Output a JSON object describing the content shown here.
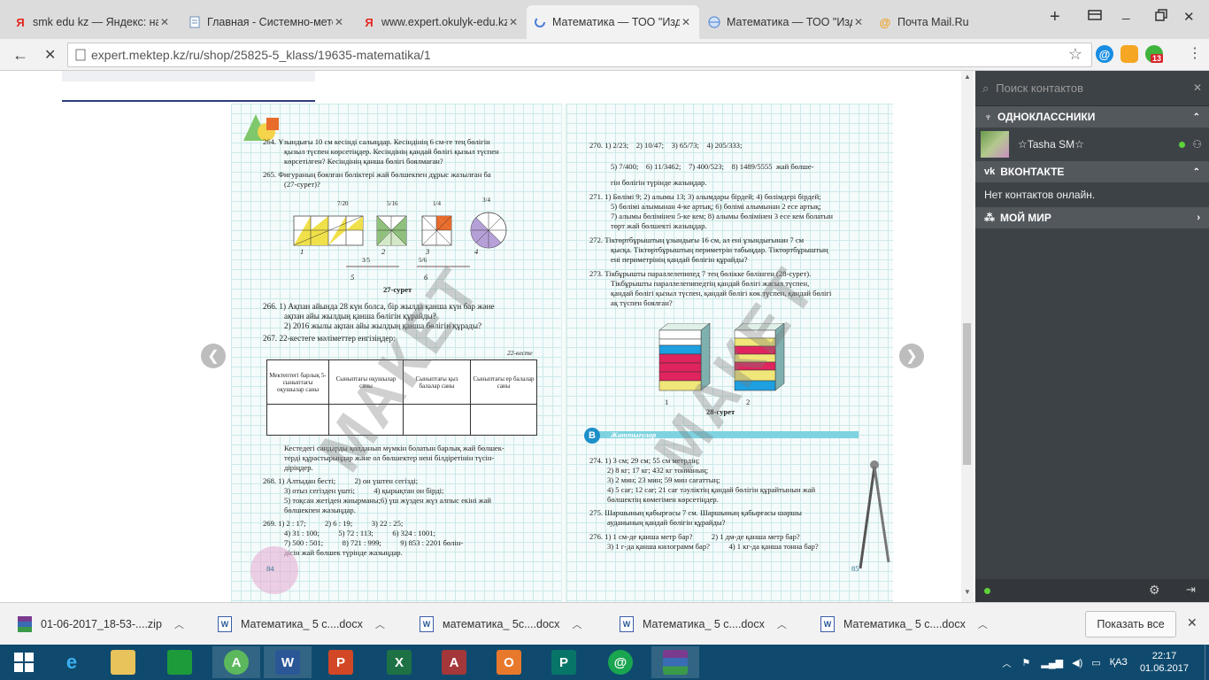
{
  "browser": {
    "tabs": [
      {
        "title": "smk edu kz — Яндекс: нашл",
        "favicon": "Я",
        "color": "#e52620",
        "active": false
      },
      {
        "title": "Главная - Системно-методи",
        "favicon": "doc",
        "color": "#6d8fc0",
        "active": false
      },
      {
        "title": "www.expert.okulyk-edu.kz —",
        "favicon": "Я",
        "color": "#e52620",
        "active": false
      },
      {
        "title": "Математика — ТОО \"Издате",
        "favicon": "loading",
        "color": "#4a7fd6",
        "active": true
      },
      {
        "title": "Математика — ТОО \"Издате",
        "favicon": "globe",
        "color": "#4a7fd6",
        "active": false
      },
      {
        "title": "Почта Mail.Ru",
        "favicon": "@",
        "color": "#f0a020",
        "active": false
      }
    ],
    "url": "expert.mektep.kz/ru/shop/25825-5_klass/19635-matematika/1",
    "badge_count": "13"
  },
  "book": {
    "left_page": {
      "lines": [
        "264. Ұзындығы 10 см кесінді салыңдар. Кесіндінің 6 см-ге тең бөлігін",
        "қызыл түспен көрсетіңдер. Кесіндінің қандай бөлігі қызыл түспен",
        "көрсетілген? Кесіндінің қанша бөлігі боялмаған?",
        "265. Фигураның боялған бөліктері жай бөлшекпен дұрыс жазылған ба",
        "(27-сурет)?"
      ],
      "fig_caption": "27-сурет",
      "fig_labels": [
        "1",
        "2",
        "3",
        "4",
        "5",
        "6"
      ],
      "fracs": [
        "7/20",
        "5/16",
        "1/4",
        "3/4",
        "3/5",
        "5/6"
      ],
      "lines2": [
        "266. 1) Ақпан айында 28 күн болса, бір жылда қанша күн бар және",
        "ақпан айы жылдың қанша бөлігін құрайды?",
        "2) 2016 жылы ақпан айы жылдың қанша бөлігін құрады?",
        "267. 22-кестеге мәліметтер енгізіңдер:"
      ],
      "table_caption": "22-кесте",
      "table_headers": [
        "Мектептегі барлық 5-сыныптағы оқушылар саны",
        "Сыныптағы оқушылар саны",
        "Сыныптағы қыз балалар саны",
        "Сыныптағы ер балалар саны"
      ],
      "lines3": [
        "Кестедегі сандарды қолданып мүмкін болатын барлық жай бөлшек-",
        "терді құрастырыңдар және ол бөлшектер нені білдіретінін түсін-",
        "діріңдер.",
        "268. 1) Алтыдан бесті;          2) он үштен сегізді;",
        "3) отыз сегізден үшті;          4) қырықтан он бірді;",
        "5) тоқсан жетіден жиырманы;6) үш жүзден жүз алпыс екіні жай",
        "бөлшекпен жазыңдар.",
        "269. 1) 2 : 17;          2) 6 : 19;          3) 22 : 25;",
        "4) 31 : 100;          5) 72 : 113;          6) 324 : 1001;",
        "7) 500 : 501;          8) 721 : 999;          9) 853 : 2201 бөлін-",
        "дісін жай бөлшек түрінде жазыңдар."
      ],
      "page_number": "84",
      "watermark": "МАКЕТ"
    },
    "right_page": {
      "ex270": [
        "270. 1) 2/23;    2) 10/47;    3) 65/73;    4) 205/333;",
        "5) 7/400;    6) 11/3462;    7) 400/523;    8) 1489/5555  жай бөлше-",
        "гін бөлігін түрінде жазыңдар."
      ],
      "lines": [
        "271. 1) Бөлімі 9; 2) алымы 13; 3) алымдары бірдей; 4) бөлімдері бірдей;",
        "5) бөлімі алымынан 4-ке артық; 6) бөлімі алымынан 2 есе артық;",
        "7) алымы бөлімінен 5-ке кем; 8) алымы бөлімінен 3 есе кем болатын",
        "төрт жай бөлшекті жазыңдар.",
        "272. Тіктөртбұрыштың ұзындығы 16 см, ал ені ұзындығынан 7 см",
        "қысқа. Тіктөртбұрыштың периметрін табыңдар. Тіктөртбұрыштың",
        "ені периметрінің қандай бөлігін құрайды?",
        "273. Тікбұрышты параллелепипед 7 тең бөлікке бөлінген (28-сурет).",
        "Тікбұрышты параллелепипедтің қандай бөлігі жасыл түспен,",
        "қандай бөлігі қызыл түспен, қандай бөлігі көк түспен, қандай бөлігі",
        "ақ түспен боялған?"
      ],
      "fig_caption": "28-сурет",
      "fig_labels": [
        "1",
        "2"
      ],
      "section_letter": "B",
      "section_title": "Жаттығулар",
      "lines2": [
        "274. 1) 3 см; 29 см; 55 см метрдің;",
        "2) 8 кг; 17 кг; 432 кг тоннаның;",
        "3) 2 мин; 23 мин; 59 мин сағаттың;",
        "4) 5 сағ; 12 сағ; 21 сағ тәуліктің қандай бөлігін құрайтынын жай",
        "бөлшектің көмегімен көрсетіңдер.",
        "275. Шаршының қабырғасы 7 см. Шаршының қабырғасы шаршы",
        "ауданының қандай бөлігін құрайды?",
        "276. 1) 1 см-де қанша метр бар?          2) 1 дм-де қанша метр бар?",
        "3) 1 г-да қанша килограмм бар?          4) 1 кг-да қанша тонна бар?"
      ],
      "page_number": "85",
      "watermark": "МАКЕТ"
    }
  },
  "sidepanel": {
    "search_placeholder": "Поиск контактов",
    "sections": [
      {
        "title": "ОДНОКЛАССНИКИ",
        "icon": "ok-icon"
      },
      {
        "title": "ВКОНТАКТЕ",
        "icon": "vk-icon"
      },
      {
        "title": "МОЙ МИР",
        "icon": "mir-icon"
      }
    ],
    "contact_name": "☆Tasha SM☆",
    "vk_empty": "Нет контактов онлайн."
  },
  "downloads": {
    "items": [
      "01-06-2017_18-53-....zip",
      "Математика_ 5 с....docx",
      "математика_ 5с....docx",
      "Математика_ 5 с....docx",
      "Математика_ 5 с....docx"
    ],
    "show_all": "Показать все"
  },
  "taskbar": {
    "lang": "ҚАЗ",
    "time": "22:17",
    "date": "01.06.2017"
  }
}
